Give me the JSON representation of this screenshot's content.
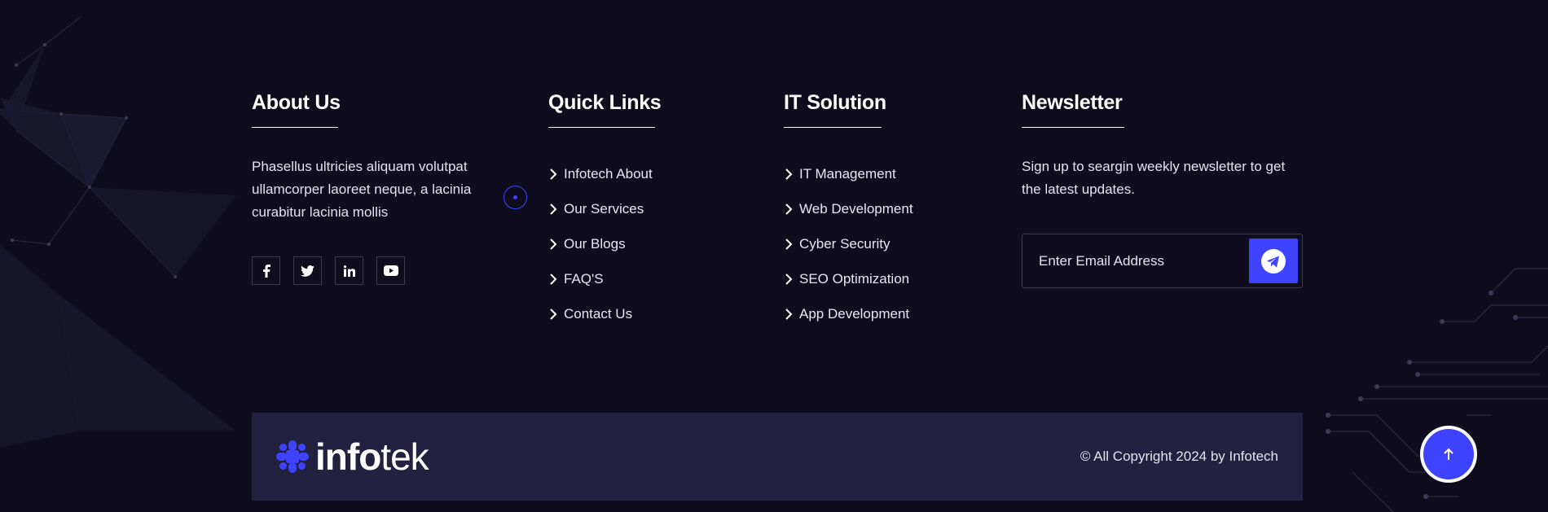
{
  "about": {
    "title": "About Us",
    "text": "Phasellus ultricies aliquam volutpat ullamcorper laoreet neque, a lacinia curabitur lacinia mollis",
    "social": [
      "facebook-icon",
      "twitter-icon",
      "linkedin-icon",
      "youtube-icon"
    ]
  },
  "quick_links": {
    "title": "Quick Links",
    "items": [
      "Infotech About",
      "Our Services",
      "Our Blogs",
      "FAQ'S",
      "Contact Us"
    ]
  },
  "it_solution": {
    "title": "IT Solution",
    "items": [
      "IT Management",
      "Web Development",
      "Cyber Security",
      "SEO Optimization",
      "App Development"
    ]
  },
  "newsletter": {
    "title": "Newsletter",
    "text": "Sign up to seargin weekly newsletter to get the latest updates.",
    "placeholder": "Enter Email Address"
  },
  "bottom": {
    "logo_part1": "info",
    "logo_part2": "tek",
    "copyright": "© All Copyright 2024 by Infotech"
  },
  "colors": {
    "background": "#0e0c1d",
    "bottom_bar": "#22213f",
    "accent": "#3e43ff"
  }
}
